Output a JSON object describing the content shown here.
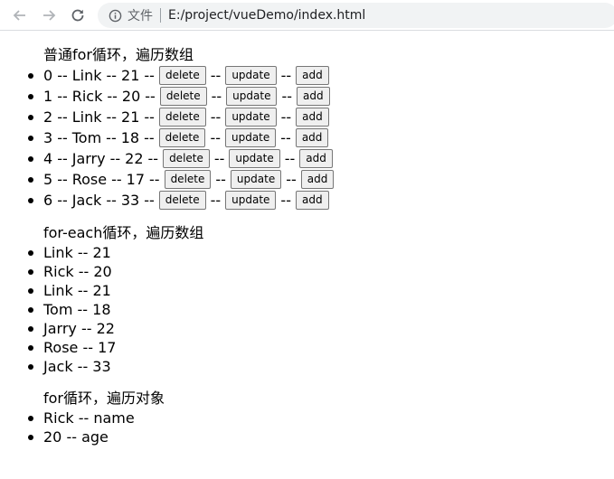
{
  "browser": {
    "site_label": "文件",
    "url": "E:/project/vueDemo/index.html"
  },
  "section1": {
    "title": "普通for循环，遍历数组",
    "separator": "--",
    "buttons": {
      "delete": "delete",
      "update": "update",
      "add": "add"
    },
    "rows": [
      {
        "index": "0",
        "name": "Link",
        "age": "21"
      },
      {
        "index": "1",
        "name": "Rick",
        "age": "20"
      },
      {
        "index": "2",
        "name": "Link",
        "age": "21"
      },
      {
        "index": "3",
        "name": "Tom",
        "age": "18"
      },
      {
        "index": "4",
        "name": "Jarry",
        "age": "22"
      },
      {
        "index": "5",
        "name": "Rose",
        "age": "17"
      },
      {
        "index": "6",
        "name": "Jack",
        "age": "33"
      }
    ]
  },
  "section2": {
    "title": "for-each循环，遍历数组",
    "items": [
      "Link -- 21",
      "Rick -- 20",
      "Link -- 21",
      "Tom -- 18",
      "Jarry -- 22",
      "Rose -- 17",
      "Jack -- 33"
    ]
  },
  "section3": {
    "title": "for循环，遍历对象",
    "items": [
      "Rick -- name",
      "20 -- age"
    ]
  }
}
